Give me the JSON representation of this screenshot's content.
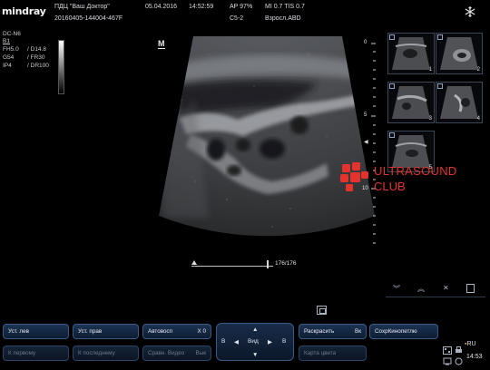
{
  "header": {
    "brand": "mindray",
    "clinic": "ПДЦ \"Ваш Доктор\"",
    "patient_id": "20160405-144004-467F",
    "date": "05.04.2016",
    "time": "14:52:59",
    "ap": "AP  97%",
    "mi_tis": "MI 0.7  TIS 0.7",
    "probe": "C5-2",
    "preset": "Взросл.ABD",
    "snowflake_icon": "snowflake-icon"
  },
  "params": {
    "mode": "DC-N6",
    "b_label": "B1",
    "row1_left": "FH5.0",
    "row1_right": "D14.8",
    "row2_left": "G54",
    "row2_right": "FR30",
    "row3_left": "IP4",
    "row3_right": "DR100"
  },
  "marker": "M",
  "depth_scale": [
    "0",
    "5",
    "10"
  ],
  "cine": {
    "counter": "176/176"
  },
  "thumbnails": [
    "1",
    "2",
    "3",
    "4",
    "5"
  ],
  "watermark": {
    "line1": "ULTRASOUND",
    "line2": "CLUB"
  },
  "bottom": {
    "row1": {
      "b1": "Уст. лев",
      "b2": "Уст. прав",
      "b3_label": "Автовосп",
      "b3_value": "X 0",
      "b5_label": "Раскрасить",
      "b5_value": "Вк",
      "b6": "СохрКинопетлю"
    },
    "row2": {
      "b1": "К первому",
      "b2": "К последнему",
      "b3_label": "Сравн. Видео",
      "b3_value": "Вык",
      "b5": "Карта цвета"
    },
    "navpad": {
      "left": "B",
      "center": "Вид",
      "right": "B"
    }
  },
  "tray": {
    "lang": "RU",
    "time": "14:53"
  },
  "colors": {
    "accent": "#3a5a86",
    "watermark": "#e4332d"
  }
}
